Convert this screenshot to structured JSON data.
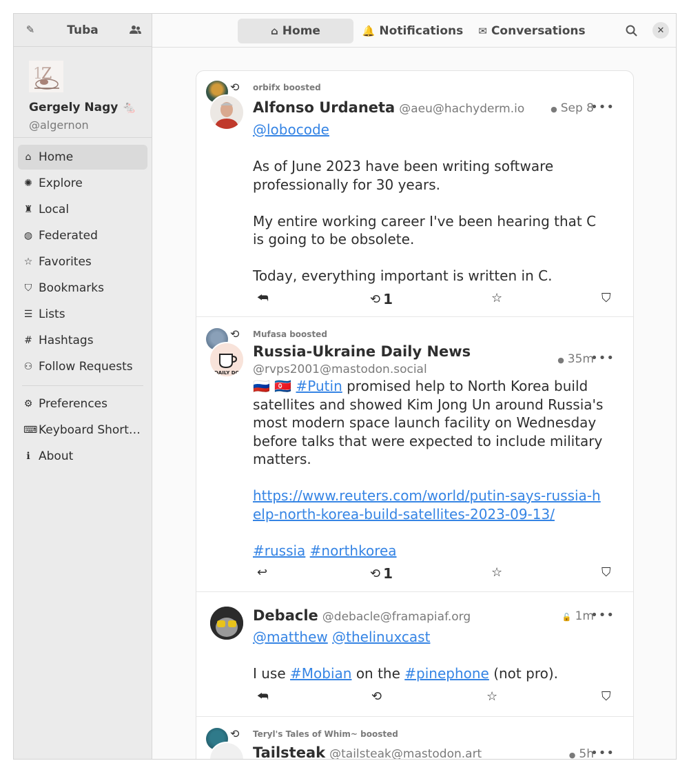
{
  "app": {
    "title": "Tuba"
  },
  "account": {
    "name": "Gergely Nagy 🐁",
    "handle": "@algernon"
  },
  "nav": {
    "primary": [
      {
        "label": "Home",
        "icon": "home-icon",
        "glyph": "⌂"
      },
      {
        "label": "Explore",
        "icon": "explore-icon",
        "glyph": "✺"
      },
      {
        "label": "Local",
        "icon": "local-icon",
        "glyph": "♜"
      },
      {
        "label": "Federated",
        "icon": "globe-icon",
        "glyph": "◍"
      },
      {
        "label": "Favorites",
        "icon": "star-icon",
        "glyph": "☆"
      },
      {
        "label": "Bookmarks",
        "icon": "bookmark-icon",
        "glyph": "⛉"
      },
      {
        "label": "Lists",
        "icon": "list-icon",
        "glyph": "☰"
      },
      {
        "label": "Hashtags",
        "icon": "hashtag-icon",
        "glyph": "#"
      },
      {
        "label": "Follow Requests",
        "icon": "follow-request-icon",
        "glyph": "⚇"
      }
    ],
    "secondary": [
      {
        "label": "Preferences",
        "icon": "gear-icon",
        "glyph": "⚙"
      },
      {
        "label": "Keyboard Short…",
        "icon": "keyboard-icon",
        "glyph": "⌨"
      },
      {
        "label": "About",
        "icon": "info-icon",
        "glyph": "ℹ"
      }
    ]
  },
  "tabs": [
    {
      "label": "Home",
      "glyph": "⌂"
    },
    {
      "label": "Notifications",
      "glyph": "🔔"
    },
    {
      "label": "Conversations",
      "glyph": "✉"
    }
  ],
  "posts": [
    {
      "boosted_by": "orbifx boosted",
      "name": "Alfonso Urdaneta",
      "handle": "@aeu@hachyderm.io",
      "time": "Sep 8",
      "mention": "@lobocode",
      "lines": [
        "As of June  2023 have been writing software professionally for 30 years.",
        "My entire working career I've been hearing that C is going to be obsolete.",
        "Today, everything important is written in C."
      ],
      "boosts": "1"
    },
    {
      "boosted_by": "Mufasa boosted",
      "name": "Russia-Ukraine Daily News",
      "handle": "@rvps2001@mastodon.social",
      "time": "35m",
      "flags": "🇷🇺 🇰🇵",
      "tag": "#Putin",
      "text": "promised help to North Korea build satellites and showed Kim Jong Un around Russia's most modern space launch facility on Wednesday before talks that were expected to include military matters.",
      "link": "https://www.reuters.com/world/putin-says-russia-help-north-korea-build-satellites-2023-09-13/",
      "tag1": "#russia",
      "tag2": "#northkorea",
      "boosts": "1"
    },
    {
      "name": "Debacle",
      "handle": "@debacle@framapiaf.org",
      "time": "1m",
      "mention1": "@matthew",
      "mention2": "@thelinuxcast",
      "t1": "I use",
      "tag1": "#Mobian",
      "t2": "on the",
      "tag2": "#pinephone",
      "t3": "(not pro)."
    },
    {
      "boosted_by": "Teryl's Tales of Whim~ boosted",
      "name": "Tailsteak",
      "handle": "@tailsteak@mastodon.art",
      "time": "5h"
    }
  ],
  "colors": {
    "accent": "#3584e4",
    "sidebar": "#ebebeb",
    "content": "#fafafa"
  }
}
